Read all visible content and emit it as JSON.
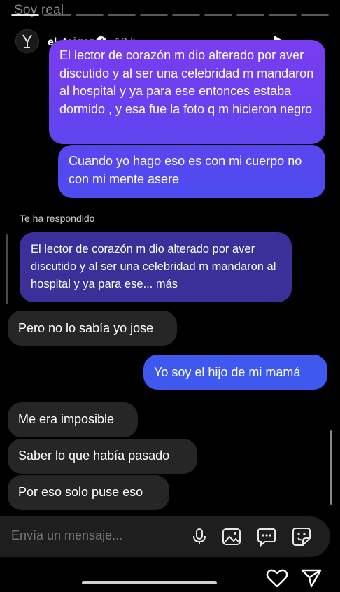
{
  "story": {
    "top_label": "Soy real",
    "progress_segments": 10,
    "active_segment": 0
  },
  "header": {
    "username": "el_taiger",
    "verified_mark": "✓",
    "time": "12 h",
    "more_label": "•••",
    "icons": {
      "play": "play-icon",
      "more": "more-icon",
      "verified": "verified-badge-icon",
      "avatar": "avatar"
    }
  },
  "messages": {
    "sent_1": "El lector de corazón m dio alterado por aver discutido y al ser una celebridad m mandaron al hospital y ya para ese entonces estaba dormido , y esa fue la foto q m hicieron negro",
    "sent_2": "Cuando yo hago eso es con mi cuerpo no con mi mente asere",
    "reply_label": "Te ha respondido",
    "quoted": "El lector de corazón m dio alterado por aver discutido y al ser una celebridad m mandaron al hospital y ya para ese... más",
    "received_1": "Pero no lo sabía yo jose",
    "sent_3": "Yo soy el hijo de mi mamá",
    "received_2": "Me era imposible",
    "received_3": "Saber lo que había pasado",
    "received_4": "Por eso solo puse eso"
  },
  "compose": {
    "placeholder": "Envía un mensaje...",
    "icons": [
      "microphone-icon",
      "image-icon",
      "chat-bubble-icon",
      "sticker-icon"
    ]
  },
  "bottom": {
    "icons": [
      "heart-icon",
      "send-icon"
    ]
  },
  "colors": {
    "background": "#000000",
    "sent_bubble_top": "#7a3df0",
    "sent_bubble_blue": "#3f58ee",
    "received_bubble": "#262626",
    "quoted_bubble": "#3b2f9a",
    "compose_bg": "#1e1e1e"
  }
}
